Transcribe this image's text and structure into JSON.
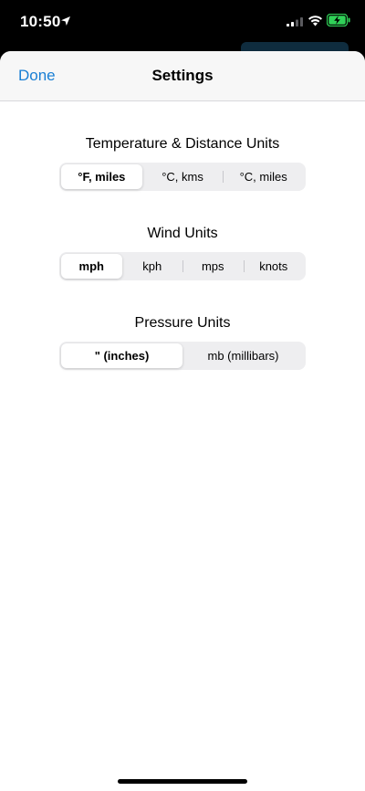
{
  "status_bar": {
    "time": "10:50",
    "icons": [
      "location-arrow-icon",
      "cellular-signal-icon",
      "wifi-icon",
      "battery-charging-icon"
    ],
    "battery_color": "#30d158"
  },
  "nav": {
    "done_label": "Done",
    "title": "Settings"
  },
  "colors": {
    "accent": "#1a7fd4",
    "segment_bg": "#eeeef0",
    "nav_bg": "#f7f7f7"
  },
  "sections": {
    "temperature": {
      "label": "Temperature & Distance Units",
      "options": [
        "°F, miles",
        "°C, kms",
        "°C, miles"
      ],
      "selected": "°F, miles"
    },
    "wind": {
      "label": "Wind Units",
      "options": [
        "mph",
        "kph",
        "mps",
        "knots"
      ],
      "selected": "mph"
    },
    "pressure": {
      "label": "Pressure Units",
      "options": [
        "\" (inches)",
        "mb (millibars)"
      ],
      "selected": "\" (inches)"
    }
  }
}
